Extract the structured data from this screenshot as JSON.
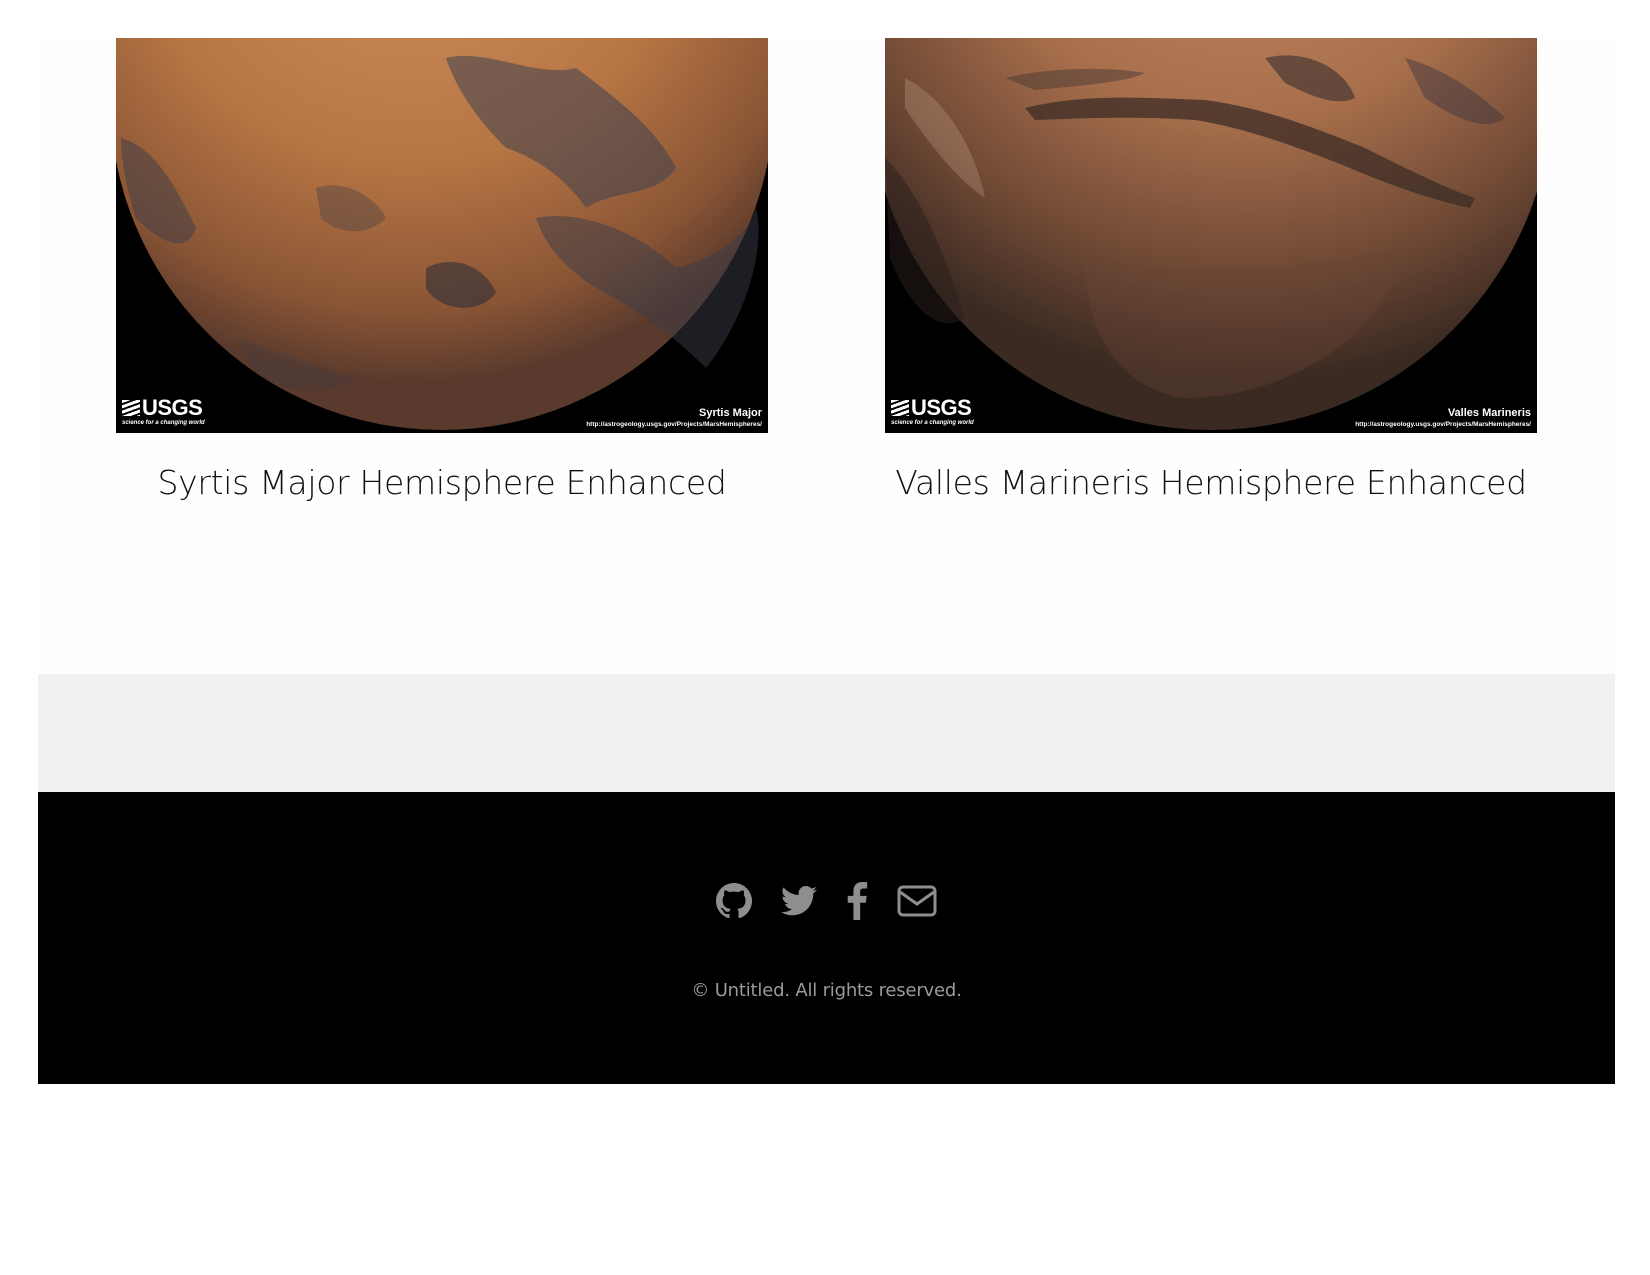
{
  "gallery": {
    "items": [
      {
        "title": "Syrtis Major Hemisphere Enhanced",
        "image_label": "Syrtis Major",
        "image_url_text": "http://astrogeology.usgs.gov/Projects/MarsHemispheres/",
        "logo_text": "USGS",
        "logo_tagline": "science for a changing world",
        "planet_color": "#b9794a"
      },
      {
        "title": "Valles Marineris Hemisphere Enhanced",
        "image_label": "Valles Marineris",
        "image_url_text": "http://astrogeology.usgs.gov/Projects/MarsHemispheres/",
        "logo_text": "USGS",
        "logo_tagline": "science for a changing world",
        "planet_color": "#a0694a"
      }
    ]
  },
  "footer": {
    "icons": [
      "github-icon",
      "twitter-icon",
      "facebook-icon",
      "envelope-icon"
    ],
    "copyright": "© Untitled. All rights reserved.",
    "icon_color": "#8e8e8e",
    "background": "#000000"
  }
}
